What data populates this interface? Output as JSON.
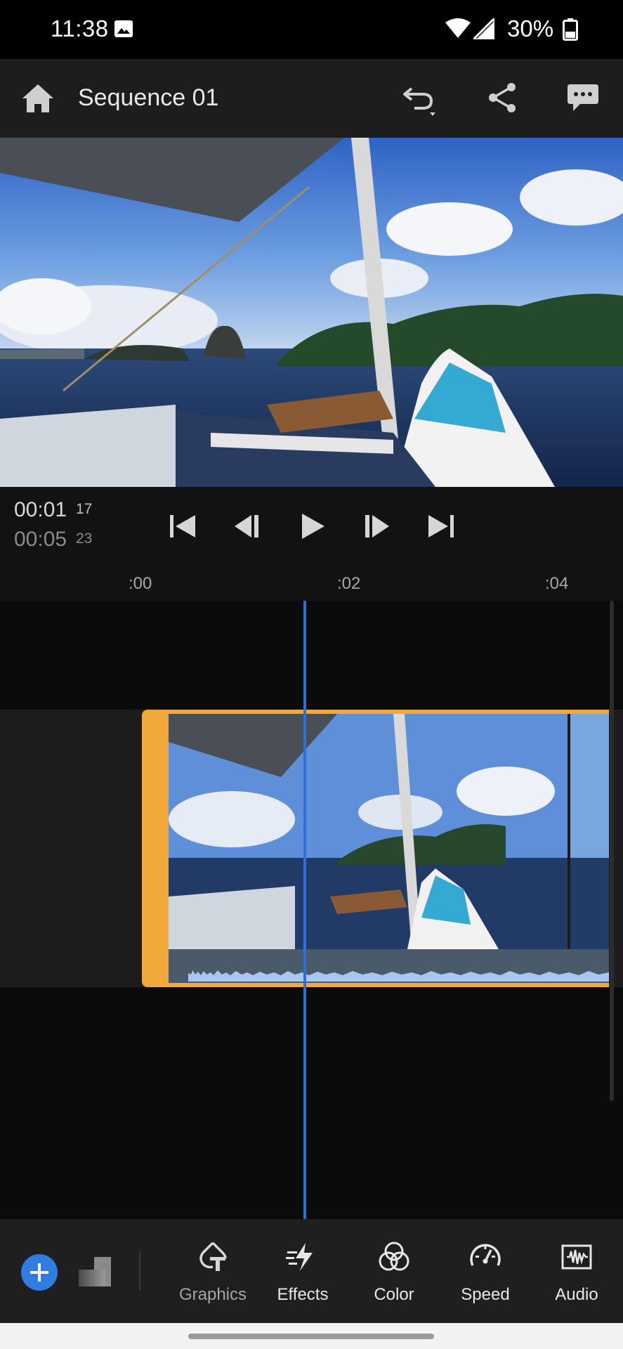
{
  "status_bar": {
    "time": "11:38",
    "battery_percent": "30%"
  },
  "app_bar": {
    "title": "Sequence 01"
  },
  "transport": {
    "current_time": "00:01",
    "current_frames": "17",
    "duration_time": "00:05",
    "duration_frames": "23"
  },
  "timeline": {
    "ruler_labels": [
      ":00",
      ":02",
      ":04"
    ]
  },
  "toolbar": {
    "tools": [
      {
        "label": "Graphics",
        "icon": "graphics-icon"
      },
      {
        "label": "Effects",
        "icon": "effects-icon"
      },
      {
        "label": "Color",
        "icon": "color-icon"
      },
      {
        "label": "Speed",
        "icon": "speed-icon"
      },
      {
        "label": "Audio",
        "icon": "audio-icon"
      }
    ]
  },
  "colors": {
    "accent_blue": "#2f7de1",
    "clip_selection": "#f1a93a",
    "playhead": "#2f6fdc"
  }
}
